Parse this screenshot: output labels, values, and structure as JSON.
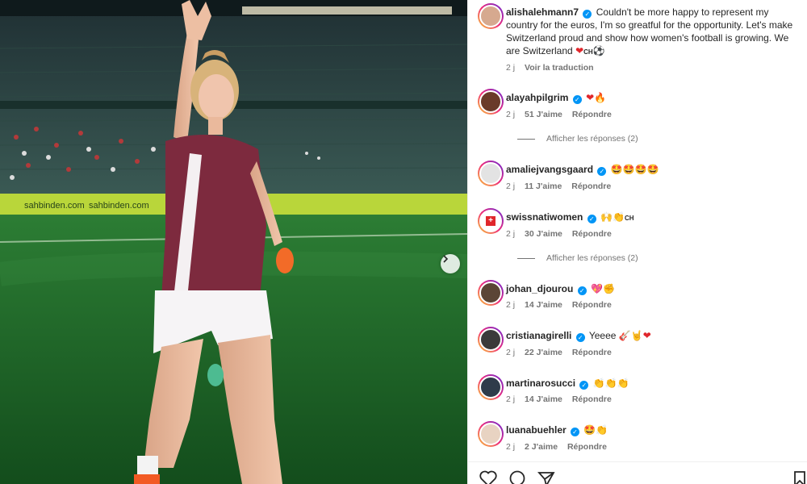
{
  "post": {
    "author": "alishalehmann7",
    "caption": "Couldn't be more happy to represent my country for the euros, I'm so greatful for the opportunity. Let's make Switzerland proud and show how women's football is growing. We are Switzerland",
    "caption_suffix": "CH",
    "age": "2 j",
    "translate_label": "Voir la traduction"
  },
  "comments": [
    {
      "user": "alayahpilgrim",
      "text": "",
      "emoji": [
        "heart-red-icon",
        "fire-icon"
      ],
      "age": "2 j",
      "likes": "51 J'aime",
      "reply": "Répondre",
      "replies_label": "Afficher les réponses (2)"
    },
    {
      "user": "amaliejvangsgaard",
      "text": "",
      "emoji": [
        "star-eyes-icon",
        "star-eyes-icon",
        "star-eyes-icon",
        "star-eyes-icon"
      ],
      "age": "2 j",
      "likes": "11 J'aime",
      "reply": "Répondre"
    },
    {
      "user": "swissnatiwomen",
      "text": "CH",
      "emoji": [
        "hands-raised-icon",
        "clap-icon"
      ],
      "age": "2 j",
      "likes": "30 J'aime",
      "reply": "Répondre",
      "replies_label": "Afficher les réponses (2)"
    },
    {
      "user": "johan_djourou",
      "text": "",
      "emoji": [
        "sparkle-heart-icon",
        "hand-icon"
      ],
      "age": "2 j",
      "likes": "14 J'aime",
      "reply": "Répondre"
    },
    {
      "user": "cristianagirelli",
      "text": "Yeeee",
      "emoji": [
        "guitar-icon",
        "rock-hand-icon",
        "heart-red-icon"
      ],
      "age": "2 j",
      "likes": "22 J'aime",
      "reply": "Répondre"
    },
    {
      "user": "martinarosucci",
      "text": "",
      "emoji": [
        "clap-icon",
        "clap-icon",
        "clap-icon"
      ],
      "age": "2 j",
      "likes": "14 J'aime",
      "reply": "Répondre"
    },
    {
      "user": "luanabuehler",
      "text": "",
      "emoji": [
        "star-eyes-icon",
        "clap-icon"
      ],
      "age": "2 j",
      "likes": "2 J'aime",
      "reply": "Répondre"
    }
  ],
  "photo": {
    "banner_text_1": "sahbinden.com",
    "banner_text_2": "sahbinden.com"
  },
  "colors": {
    "link_blue": "#0095f6",
    "jersey": "#7d2a3e",
    "pitch": "#1f6a2a"
  }
}
